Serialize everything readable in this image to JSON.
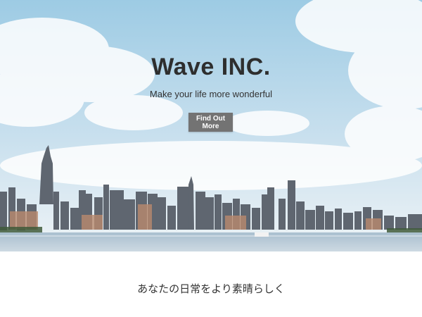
{
  "hero": {
    "title": "Wave INC.",
    "subtitle": "Make your life more wonderful",
    "cta_label": "Find Out More"
  },
  "section": {
    "tagline": "あなたの日常をより素晴らしく"
  },
  "colors": {
    "sky_top": "#9fcde6",
    "sky_bottom": "#e9f1f6",
    "water": "#b9cbd7",
    "button": "#737373",
    "title": "#2e2e2e"
  }
}
